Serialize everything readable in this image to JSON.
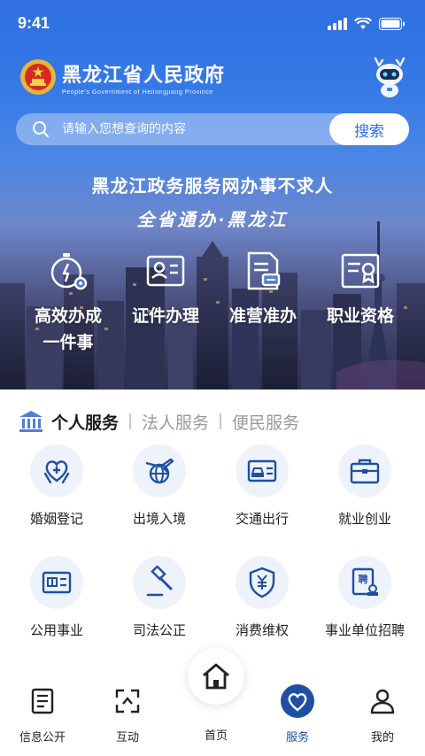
{
  "status_bar": {
    "time": "9:41"
  },
  "header": {
    "logo_title": "黑龙江省人民政府",
    "logo_subtitle": "People's Government of Heilongjiang Province"
  },
  "search": {
    "placeholder": "请输入您想查询的内容",
    "button_label": "搜索"
  },
  "banner": {
    "slogan": "黑龙江政务服务网办事不求人",
    "slogan2": "全省通办·黑龙江",
    "quick_items": [
      {
        "label_line1": "高效办成",
        "label_line2": "一件事",
        "icon": "stopwatch-gear-icon"
      },
      {
        "label_line1": "证件办理",
        "label_line2": "",
        "icon": "id-card-icon"
      },
      {
        "label_line1": "准营准办",
        "label_line2": "",
        "icon": "license-document-icon"
      },
      {
        "label_line1": "职业资格",
        "label_line2": "",
        "icon": "certificate-icon"
      }
    ]
  },
  "service_tabs": {
    "items": [
      "个人服务",
      "法人服务",
      "便民服务"
    ],
    "active": "个人服务"
  },
  "services": [
    {
      "label": "婚姻登记",
      "icon": "heart-hands-icon"
    },
    {
      "label": "出境入境",
      "icon": "plane-globe-icon"
    },
    {
      "label": "交通出行",
      "icon": "car-card-icon"
    },
    {
      "label": "就业创业",
      "icon": "briefcase-icon"
    },
    {
      "label": "公用事业",
      "icon": "utility-card-icon"
    },
    {
      "label": "司法公正",
      "icon": "gavel-icon"
    },
    {
      "label": "消费维权",
      "icon": "yuan-shield-icon"
    },
    {
      "label": "事业单位招聘",
      "icon": "recruit-stamp-icon"
    }
  ],
  "bottom_nav": {
    "items": [
      {
        "label": "信息公开",
        "icon": "document-icon"
      },
      {
        "label": "互动",
        "icon": "interaction-icon"
      },
      {
        "label": "首页",
        "icon": "home-icon"
      },
      {
        "label": "服务",
        "icon": "heart-circle-icon"
      },
      {
        "label": "我的",
        "icon": "user-icon"
      }
    ],
    "active": "服务"
  },
  "colors": {
    "primary": "#1f4fa3",
    "accent": "#2e6ede",
    "icon_bg": "#eef3fb"
  }
}
